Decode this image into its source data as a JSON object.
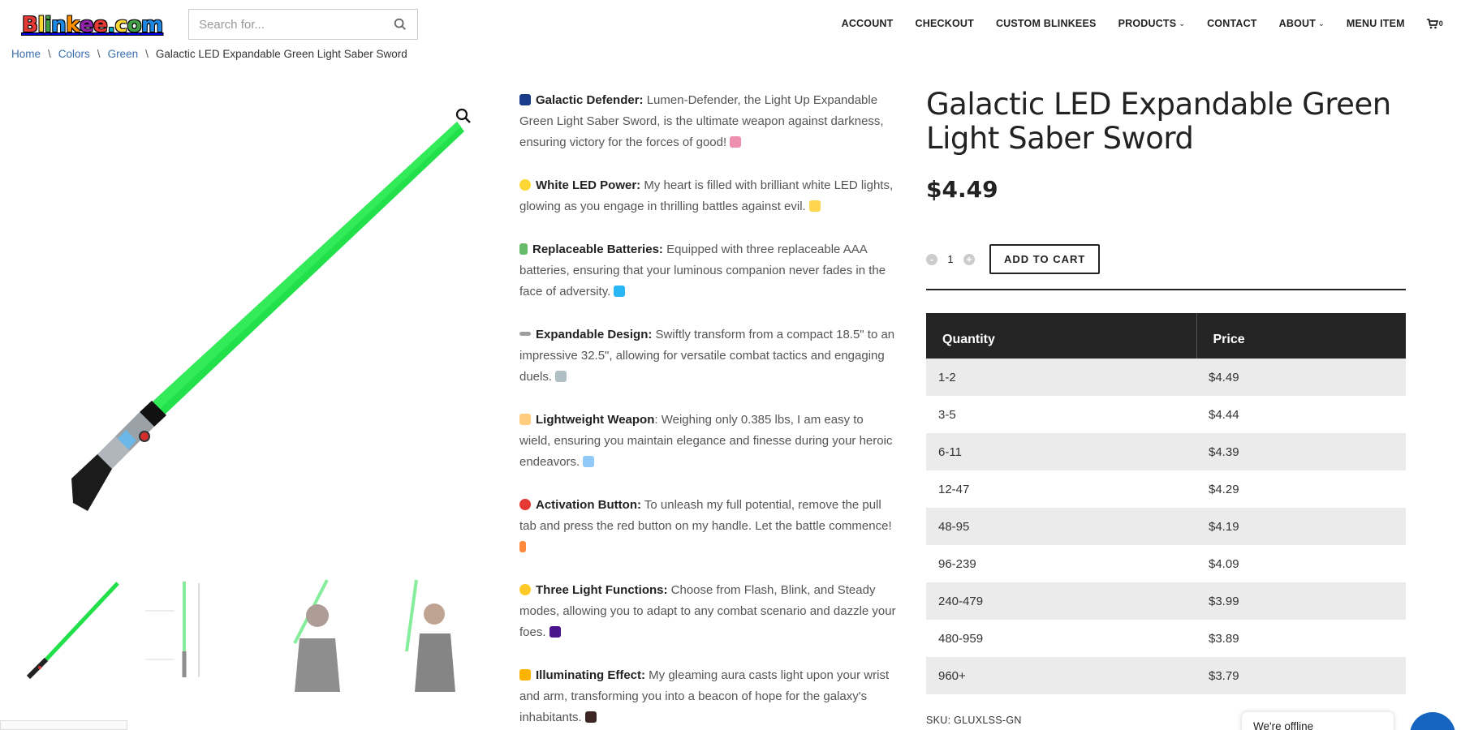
{
  "header": {
    "logo": "Blinkee.com",
    "search_placeholder": "Search for...",
    "nav": [
      {
        "label": "ACCOUNT"
      },
      {
        "label": "CHECKOUT"
      },
      {
        "label": "CUSTOM BLINKEES"
      },
      {
        "label": "PRODUCTS"
      },
      {
        "label": "CONTACT"
      },
      {
        "label": "ABOUT"
      },
      {
        "label": "MENU ITEM"
      }
    ],
    "cart_count": "0"
  },
  "breadcrumb": {
    "items": [
      "Home",
      "Colors",
      "Green"
    ],
    "current": "Galactic LED Expandable Green Light Saber Sword"
  },
  "description": [
    {
      "title": "Galactic Defender:",
      "text": " Lumen-Defender, the Light Up Expandable Green Light Saber Sword, is the ultimate weapon against darkness, ensuring victory for the forces of good!",
      "icon": "galaxy-icon",
      "tail_icon": "rocket-icon"
    },
    {
      "title": "White LED Power:",
      "text": " My heart is filled with brilliant white LED lights, glowing as you engage in thrilling battles against evil.",
      "icon": "bulb-icon",
      "tail_icon": "sparkles-icon"
    },
    {
      "title": "Replaceable Batteries:",
      "text": " Equipped with three replaceable AAA batteries, ensuring that your luminous companion never fades in the face of adversity.",
      "icon": "battery-icon",
      "tail_icon": "repeat-icon"
    },
    {
      "title": "Expandable Design:",
      "text": " Swiftly transform from a compact 18.5\" to an impressive 32.5\", allowing for versatile combat tactics and engaging duels.",
      "icon": "ruler-icon",
      "tail_icon": "crossed-swords-icon"
    },
    {
      "title": "Lightweight Weapon",
      "text": ": Weighing only 0.385 lbs, I am easy to wield, ensuring you maintain elegance and finesse during your heroic endeavors.",
      "icon": "feather-icon",
      "tail_icon": "fencer-icon"
    },
    {
      "title": "Activation Button:",
      "text": " To unleash my full potential, remove the pull tab and press the red button on my handle. Let the battle commence!",
      "icon": "red-circle-icon",
      "tail_icon": "lightning-icon"
    },
    {
      "title": "Three Light Functions:",
      "text": " Choose from Flash, Blink, and Steady modes, allowing you to adapt to any combat scenario and dazzle your foes.",
      "icon": "sun-icon",
      "tail_icon": "firework-icon"
    },
    {
      "title": "Illuminating Effect:",
      "text": " My gleaming aura casts light upon your wrist and arm, transforming you into a beacon of hope for the galaxy's inhabitants.",
      "icon": "dizzy-icon",
      "tail_icon": "sparkler-icon"
    }
  ],
  "product": {
    "title": "Galactic LED Expandable Green Light Saber Sword",
    "price": "$4.49",
    "quantity": "1",
    "minus": "-",
    "plus": "+",
    "add_to_cart": "ADD TO CART",
    "sku": "SKU: GLUXLSS-GN"
  },
  "pricing_table": {
    "headers": [
      "Quantity",
      "Price"
    ],
    "rows": [
      [
        "1-2",
        "$4.49"
      ],
      [
        "3-5",
        "$4.44"
      ],
      [
        "6-11",
        "$4.39"
      ],
      [
        "12-47",
        "$4.29"
      ],
      [
        "48-95",
        "$4.19"
      ],
      [
        "96-239",
        "$4.09"
      ],
      [
        "240-479",
        "$3.99"
      ],
      [
        "480-959",
        "$3.89"
      ],
      [
        "960+",
        "$3.79"
      ]
    ]
  },
  "chat": {
    "status": "We're offline"
  },
  "colors": {
    "accent_link": "#3a6fb0",
    "saber_green": "#22e04a",
    "table_header": "#242424",
    "chat_blue": "#1565c0"
  }
}
